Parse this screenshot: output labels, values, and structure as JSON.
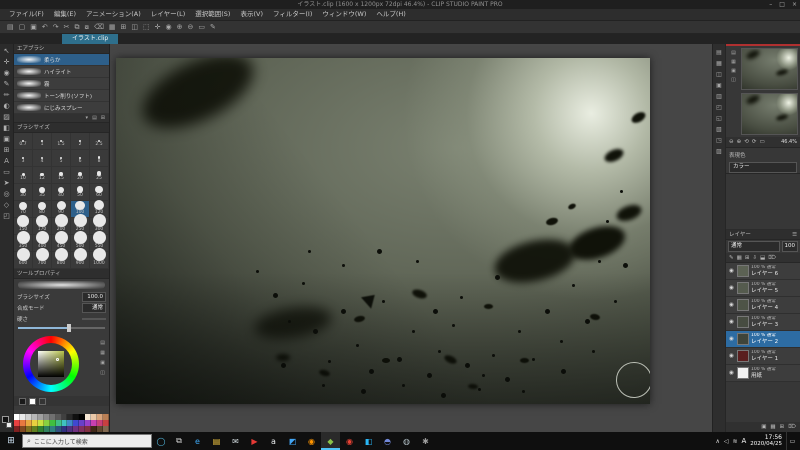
{
  "accent": "#2d7dc2",
  "window": {
    "title": "イラスト.clip (1600 x 1200px 72dpi 46.4%) - CLIP STUDIO PAINT PRO",
    "controls": [
      {
        "name": "minimize",
        "glyph": "–"
      },
      {
        "name": "maximize",
        "glyph": "□"
      },
      {
        "name": "close",
        "glyph": "×"
      }
    ]
  },
  "menubar": {
    "items": [
      "ファイル(F)",
      "編集(E)",
      "アニメーション(A)",
      "レイヤー(L)",
      "選択範囲(S)",
      "表示(V)",
      "フィルター(I)",
      "ウィンドウ(W)",
      "ヘルプ(H)"
    ]
  },
  "toolbar": {
    "icons": [
      "▤",
      "▢",
      "▣",
      "↶",
      "↷",
      "✂",
      "⧉",
      "⧇",
      "⌫",
      "▦",
      "⊞",
      "◫",
      "⬚",
      "✛",
      "◉",
      "⊕",
      "⊖",
      "▭",
      "✎"
    ]
  },
  "doc_tab": {
    "label": "イラスト.clip"
  },
  "tool_strip": {
    "icons": [
      "↖",
      "✛",
      "◉",
      "✎",
      "✏",
      "◐",
      "▨",
      "◧",
      "▣",
      "⊞",
      "A",
      "▭",
      "➤",
      "◎",
      "◇",
      "◰"
    ]
  },
  "subtool": {
    "title": "エアブラシ",
    "items": [
      {
        "name": "柔らか",
        "selected": true
      },
      {
        "name": "ハイライト",
        "selected": false
      },
      {
        "name": "霧",
        "selected": false
      },
      {
        "name": "トーン削り(ソフト)",
        "selected": false
      },
      {
        "name": "にじみスプレー",
        "selected": false
      }
    ],
    "footer_icons": [
      "▾",
      "▤",
      "⊞"
    ]
  },
  "brush_sizes": {
    "title": "ブラシサイズ",
    "selected": 100,
    "sizes": [
      0.7,
      1,
      1.5,
      2,
      2.5,
      3,
      4,
      5,
      6,
      8,
      10,
      12,
      15,
      20,
      25,
      30,
      35,
      40,
      50,
      60,
      70,
      80,
      90,
      100,
      120,
      150,
      170,
      200,
      250,
      300,
      350,
      400,
      450,
      500,
      550,
      600,
      700,
      800,
      900,
      1000
    ]
  },
  "tool_property": {
    "title": "ツールプロパティ",
    "rows": [
      {
        "label": "ブラシサイズ",
        "value": "100.0"
      },
      {
        "label": "合成モード",
        "value": "通常"
      },
      {
        "label": "硬さ",
        "value": ""
      }
    ]
  },
  "color_wheel": {
    "selected_hex": "#b7c24a"
  },
  "color_chips": [
    {
      "name": "main-color",
      "hex": "#1a1a1a"
    },
    {
      "name": "sub-color",
      "hex": "#ffffff"
    },
    {
      "name": "transparent-color",
      "hex": "none"
    }
  ],
  "swatches": {
    "colors": [
      "#ffffff",
      "#e8e8e8",
      "#d0d0d0",
      "#b8b8b8",
      "#a0a0a0",
      "#888888",
      "#707070",
      "#585858",
      "#404040",
      "#282828",
      "#101010",
      "#000000",
      "#f5e6d3",
      "#eac8a8",
      "#d9a47c",
      "#b97f55",
      "#e84040",
      "#e87840",
      "#e8a840",
      "#e8d040",
      "#c8e040",
      "#88d040",
      "#40c040",
      "#40c088",
      "#40c0c0",
      "#4088c8",
      "#4048d0",
      "#6840c8",
      "#9840c8",
      "#c840b0",
      "#c84078",
      "#c84040",
      "#802020",
      "#804820",
      "#807020",
      "#608020",
      "#308030",
      "#308060",
      "#308080",
      "#305080",
      "#303080",
      "#503080",
      "#703080",
      "#803060",
      "#803040",
      "#402818",
      "#604830",
      "#806850"
    ]
  },
  "dock_icons": [
    "▤",
    "▦",
    "◫",
    "▣",
    "▥",
    "◰",
    "◱",
    "▧",
    "◳",
    "▨"
  ],
  "navigator": {
    "zoom": "46.4%",
    "buttons": [
      "⊖",
      "⊕",
      "⟲",
      "⟳",
      "▭"
    ],
    "side_icons": [
      "▤",
      "▦",
      "▣",
      "◫"
    ]
  },
  "expression": {
    "label": "表現色",
    "value": "カラー"
  },
  "layers": {
    "title": "レイヤー",
    "blend": "通常",
    "opacity": "100",
    "toolbar_icons": [
      "✎",
      "▦",
      "⊞",
      "⇩",
      "⬓",
      "⌦"
    ],
    "footer_icons": [
      "▣",
      "▦",
      "⊞",
      "⌦"
    ],
    "items": [
      {
        "mode": "100 % 通常",
        "name": "レイヤー 6",
        "thumb": "#5c6254",
        "selected": false
      },
      {
        "mode": "100 % 通常",
        "name": "レイヤー 5",
        "thumb": "#555b4e",
        "selected": false
      },
      {
        "mode": "100 % 通常",
        "name": "レイヤー 4",
        "thumb": "#4e5447",
        "selected": false
      },
      {
        "mode": "100 % 通常",
        "name": "レイヤー 3",
        "thumb": "#474c41",
        "selected": false
      },
      {
        "mode": "100 % 通常",
        "name": "レイヤー 2",
        "thumb": "#3f443a",
        "selected": true
      },
      {
        "mode": "100 % 通常",
        "name": "レイヤー 1",
        "thumb": "#5a1f1f",
        "selected": false
      },
      {
        "mode": "100 % 通常",
        "name": "用紙",
        "thumb": "#f2f2f2",
        "selected": false
      }
    ]
  },
  "taskbar": {
    "start": "⊞",
    "search": {
      "placeholder": "ここに入力して検索"
    },
    "system_icons": [
      {
        "name": "cortana",
        "glyph": "◯",
        "color": "#58c7f0"
      },
      {
        "name": "task-view",
        "glyph": "⧉",
        "color": "#d8d8d8"
      }
    ],
    "app_icons": [
      {
        "name": "edge",
        "glyph": "e",
        "color": "#3fa9f5",
        "active": false
      },
      {
        "name": "file-explorer",
        "glyph": "▤",
        "color": "#f5c842",
        "active": false
      },
      {
        "name": "mail",
        "glyph": "✉",
        "color": "#cfd8dc",
        "active": false
      },
      {
        "name": "video",
        "glyph": "▶",
        "color": "#e53935",
        "active": false
      },
      {
        "name": "amazon",
        "glyph": "a",
        "color": "#eceff1",
        "active": false
      },
      {
        "name": "photos",
        "glyph": "◩",
        "color": "#42a5f5",
        "active": false
      },
      {
        "name": "firefox",
        "glyph": "◉",
        "color": "#ff9500",
        "active": false
      },
      {
        "name": "clip-studio",
        "glyph": "◆",
        "color": "#8bc34a",
        "active": true
      },
      {
        "name": "chrome",
        "glyph": "◉",
        "color": "#ea4335",
        "active": false
      },
      {
        "name": "code",
        "glyph": "◧",
        "color": "#29b6f6",
        "active": false
      },
      {
        "name": "chat",
        "glyph": "◓",
        "color": "#7289da",
        "active": false
      },
      {
        "name": "steam",
        "glyph": "◍",
        "color": "#b0bec5",
        "active": false
      },
      {
        "name": "settings",
        "glyph": "✱",
        "color": "#9e9e9e",
        "active": false
      }
    ],
    "tray": {
      "icons": [
        {
          "name": "tray-expand",
          "glyph": "∧"
        },
        {
          "name": "volume",
          "glyph": "◁"
        },
        {
          "name": "network",
          "glyph": "≋"
        }
      ],
      "ime": "A",
      "time": "17:56",
      "date": "2020/04/25"
    }
  }
}
